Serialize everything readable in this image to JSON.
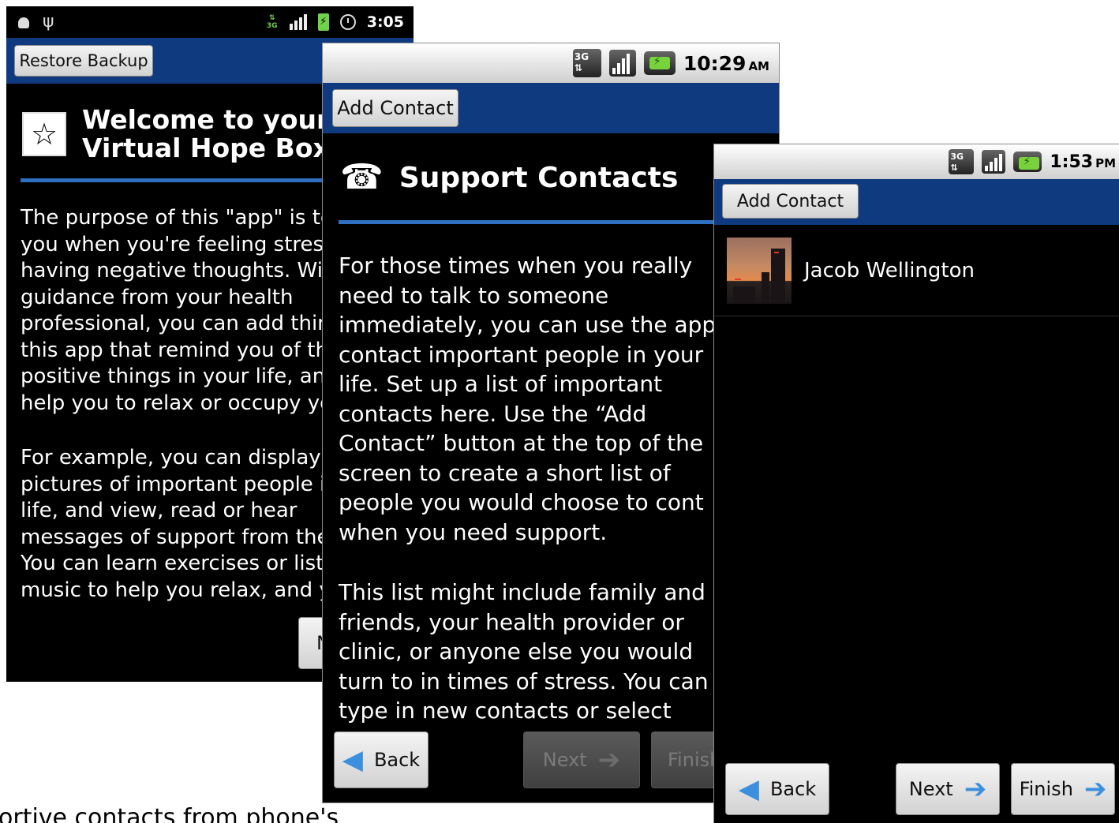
{
  "caption": "ortive contacts from phone's",
  "screen1": {
    "status": {
      "time": "3:05"
    },
    "top_button": "Restore Backup",
    "heading_line1": "Welcome to your",
    "heading_line2": "Virtual Hope Box",
    "para1": [
      "The purpose of this \"app\" is to",
      "you when you're feeling stress",
      "having negative thoughts.  Wit",
      "guidance from your health",
      "professional, you can add thin",
      "this app that remind you of th",
      "positive things in your life, and",
      "help you to relax or occupy yo"
    ],
    "para2": [
      "For example, you can display",
      "pictures of important people i",
      "life, and view, read or hear",
      "messages of support from the",
      "You can learn exercises or list",
      "music to help you relax, and y"
    ],
    "next_partial": "N"
  },
  "screen2": {
    "status": {
      "time": "10:29",
      "ampm": "AM"
    },
    "top_button": "Add Contact",
    "heading": "Support Contacts",
    "para1": [
      "For those times when you really",
      "need to talk to someone",
      "immediately, you can use the app",
      "contact important people in your",
      "life. Set up a list of important",
      "contacts here. Use the “Add",
      "Contact” button at the top of the",
      "screen to create a short list of",
      "people you would choose to cont",
      "when you need support."
    ],
    "para2": [
      "This list might include family and",
      "friends, your health provider or",
      "clinic, or anyone else you would",
      "turn to in times of stress. You can",
      "type in new contacts or select"
    ],
    "back": "Back",
    "next": "Next",
    "finish": "Finish"
  },
  "screen3": {
    "status": {
      "time": "1:53",
      "ampm": "PM"
    },
    "top_button": "Add Contact",
    "contacts": [
      {
        "name": "Jacob Wellington"
      }
    ],
    "back": "Back",
    "next": "Next",
    "finish": "Finish"
  },
  "colors": {
    "action_bar": "#0f3a80",
    "divider": "#2f6fc1",
    "arrow": "#3c8fdc"
  }
}
